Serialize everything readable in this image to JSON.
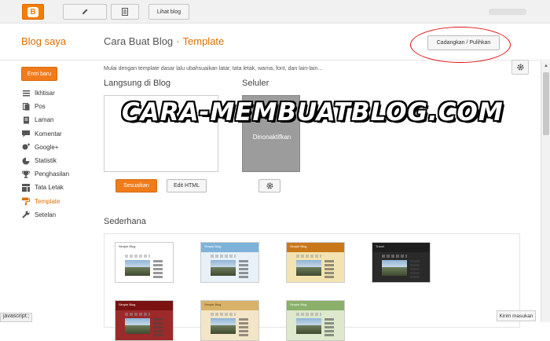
{
  "topbar": {
    "lihat_blog_label": "Lihat blog"
  },
  "header": {
    "brand": "Blog saya",
    "blog_title": "Cara Buat Blog",
    "separator": "·",
    "current_page": "Template",
    "backup_button_label": "Cadangkan / Pulihkan"
  },
  "sidebar": {
    "new_post_label": "Entri baru",
    "items": [
      {
        "label": "Ikhtisar",
        "icon": "list-icon"
      },
      {
        "label": "Pos",
        "icon": "posts-icon"
      },
      {
        "label": "Laman",
        "icon": "pages-icon"
      },
      {
        "label": "Komentar",
        "icon": "comment-icon"
      },
      {
        "label": "Google+",
        "icon": "google-plus-icon"
      },
      {
        "label": "Statistik",
        "icon": "stats-icon"
      },
      {
        "label": "Penghasilan",
        "icon": "trophy-icon"
      },
      {
        "label": "Tata Letak",
        "icon": "layout-icon"
      },
      {
        "label": "Template",
        "icon": "paint-roller-icon",
        "active": true
      },
      {
        "label": "Setelan",
        "icon": "wrench-icon"
      }
    ]
  },
  "main": {
    "intro": "Mulai dengan template dasar lalu ubahsuaikan latar, tata letak, warna, font, dan lain-lain...",
    "live_heading": "Langsung di Blog",
    "mobile_heading": "Seluler",
    "mobile_status": "Dinonaktifkan",
    "customize_label": "Sesuaikan",
    "edit_html_label": "Edit HTML",
    "simple_heading": "Sederhana",
    "templates": [
      {
        "title": "Simple Blog",
        "header_color": "#ffffff",
        "bg": "#ffffff",
        "text_color": "#333333"
      },
      {
        "title": "Simple Blog",
        "header_color": "#7fb2d9",
        "bg": "#e8f1f8",
        "text_color": "#ffffff"
      },
      {
        "title": "Simple Blog",
        "header_color": "#c8781a",
        "bg": "#f2e3b0",
        "text_color": "#ffffff"
      },
      {
        "title": "Travel",
        "header_color": "#1e1e1e",
        "bg": "#2a2a2a",
        "text_color": "#dddddd"
      },
      {
        "title": "Simple Blog",
        "header_color": "#7a1212",
        "bg": "#9c2a2a",
        "text_color": "#ffffff"
      },
      {
        "title": "Simple Blog",
        "header_color": "#d9b26a",
        "bg": "#f3e6c8",
        "text_color": "#5a3a10"
      },
      {
        "title": "Simple Blog",
        "header_color": "#8ab06a",
        "bg": "#dde8cc",
        "text_color": "#ffffff"
      }
    ]
  },
  "watermark": "CARA-MEMBUATBLOG.COM",
  "status_bar": "javascript:;",
  "feedback_label": "Kirim masukan",
  "colors": {
    "accent": "#dd6f00",
    "button_orange": "#f07b1b",
    "annotation_red": "#e01010"
  }
}
